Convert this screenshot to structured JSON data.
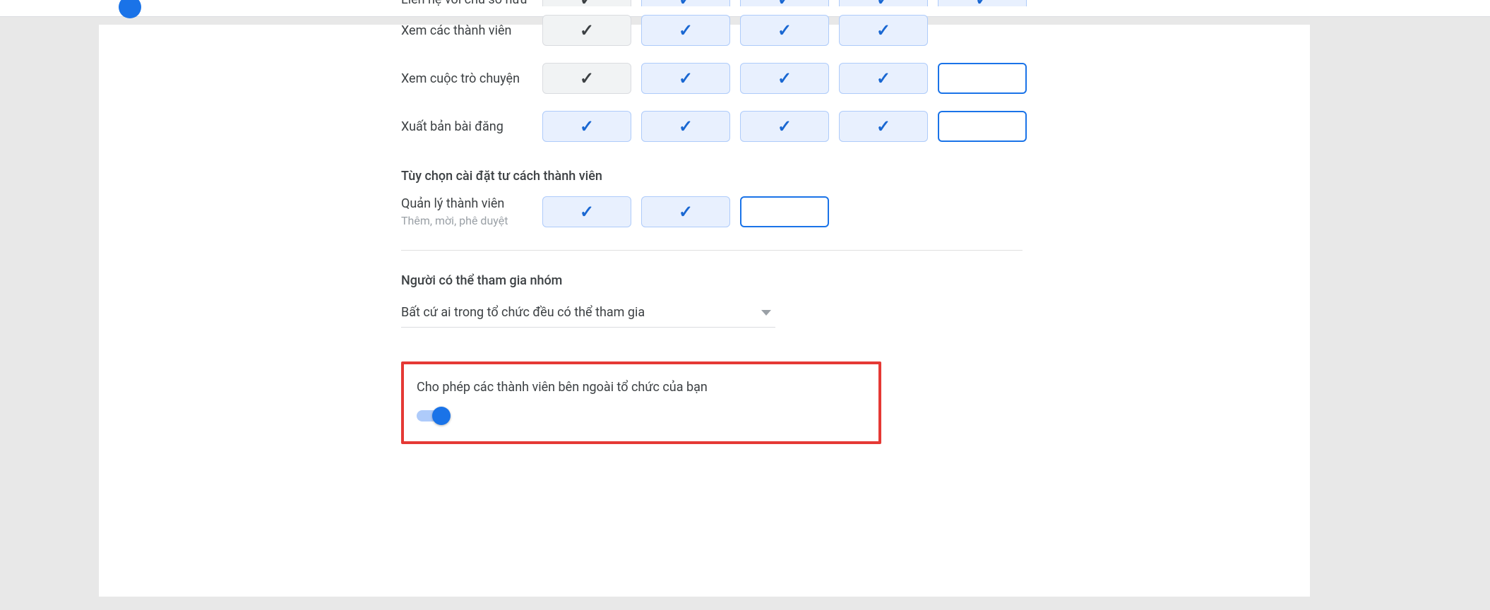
{
  "permissions": {
    "row0": {
      "label": "Liên hệ với chủ sở hữu",
      "cells": [
        "grey",
        "blue",
        "blue",
        "blue",
        "blue"
      ]
    },
    "row1": {
      "label": "Xem các thành viên",
      "cells": [
        "grey",
        "blue",
        "blue",
        "blue"
      ]
    },
    "row2": {
      "label": "Xem cuộc trò chuyện",
      "cells": [
        "grey",
        "blue",
        "blue",
        "blue",
        "outline"
      ]
    },
    "row3": {
      "label": "Xuất bản bài đăng",
      "cells": [
        "blue",
        "blue",
        "blue",
        "blue",
        "outline"
      ]
    }
  },
  "membership_section_title": "Tùy chọn cài đặt tư cách thành viên",
  "manage": {
    "label": "Quản lý thành viên",
    "sub": "Thêm, mời, phê duyệt",
    "cells": [
      "blue",
      "blue",
      "outline"
    ]
  },
  "join": {
    "label": "Người có thể tham gia nhóm",
    "selected": "Bất cứ ai trong tổ chức đều có thể tham gia"
  },
  "external": {
    "label": "Cho phép các thành viên bên ngoài tổ chức của bạn",
    "toggle_on": true
  }
}
